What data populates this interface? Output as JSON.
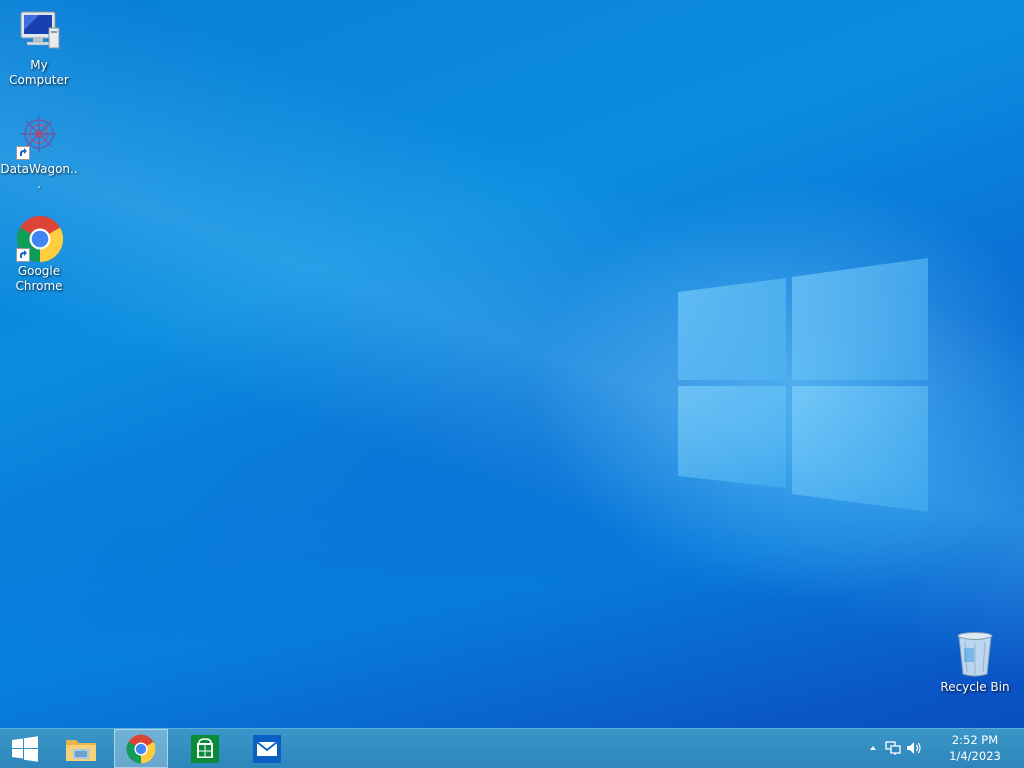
{
  "desktop": {
    "icons": [
      {
        "label": "My Computer",
        "icon": "computer-icon"
      },
      {
        "label": "DataWagon...",
        "icon": "datawagon-icon"
      },
      {
        "label": "Google Chrome",
        "icon": "chrome-icon"
      },
      {
        "label": "Recycle Bin",
        "icon": "recycle-bin-icon"
      }
    ],
    "wallpaper_colors": {
      "base": "#0a7fd6",
      "deep": "#0a4fc2",
      "glow": "#78d2ff"
    }
  },
  "taskbar": {
    "buttons": [
      {
        "name": "start",
        "icon": "windows-start-icon"
      },
      {
        "name": "file-explorer",
        "icon": "folder-icon"
      },
      {
        "name": "chrome",
        "icon": "chrome-icon",
        "active": true
      },
      {
        "name": "store",
        "icon": "store-icon"
      },
      {
        "name": "mail",
        "icon": "mail-icon"
      }
    ],
    "tray": {
      "icons": [
        "chevron-up-icon",
        "network-icon",
        "volume-icon"
      ],
      "time": "2:52 PM",
      "date": "1/4/2023"
    },
    "color": "#2e86bb"
  }
}
